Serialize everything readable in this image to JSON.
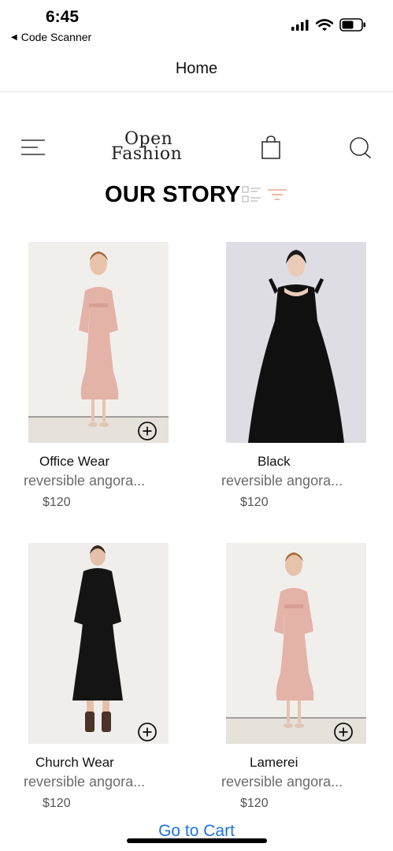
{
  "status_bar": {
    "time": "6:45",
    "back_app": "Code Scanner",
    "icons": [
      "cellular-signal-icon",
      "wifi-icon",
      "battery-icon"
    ]
  },
  "nav": {
    "title": "Home"
  },
  "header": {
    "logo_line1": "Open",
    "logo_line2": "Fashion",
    "icons": [
      "menu-icon",
      "shopping-bag-icon",
      "search-icon"
    ]
  },
  "section": {
    "title": "OUR STORY",
    "icons": [
      "list-view-icon",
      "filter-icon"
    ],
    "accent_color": "#f0a78a"
  },
  "products": [
    {
      "name": "Office Wear",
      "description": "reversible angora...",
      "price": "$120",
      "dress_color": "#e5b5ab"
    },
    {
      "name": "Black",
      "description": "reversible angora...",
      "price": "$120",
      "dress_color": "#111111"
    },
    {
      "name": "Church Wear",
      "description": "reversible angora...",
      "price": "$120",
      "dress_color": "#1a1a1a"
    },
    {
      "name": "Lamerei",
      "description": "reversible angora...",
      "price": "$120",
      "dress_color": "#e5b5ab"
    }
  ],
  "footer": {
    "go_to_cart": "Go to Cart",
    "link_color": "#1e72e8"
  }
}
